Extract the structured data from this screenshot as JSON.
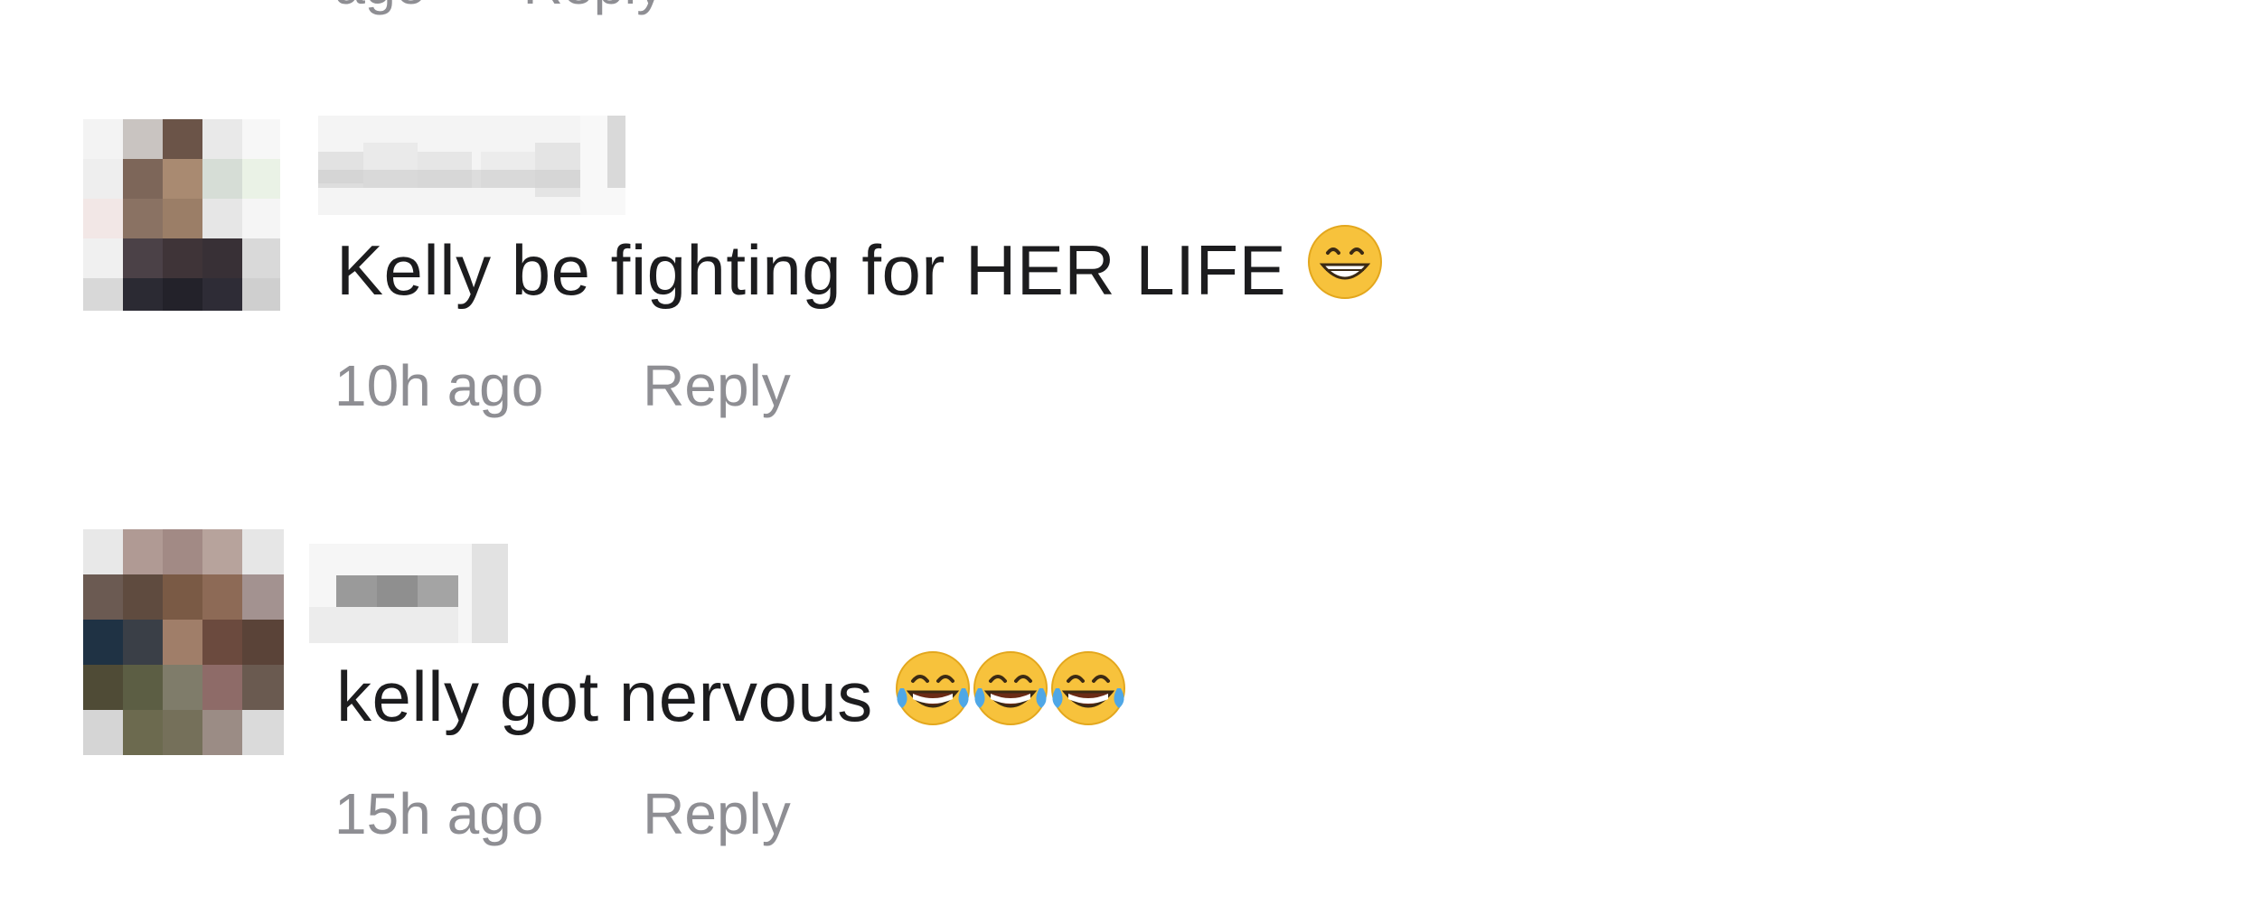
{
  "previous_comment": {
    "meta_partial": [
      "ago",
      "Reply"
    ]
  },
  "comments": [
    {
      "username": "",
      "text": "Kelly be fighting for HER LIFE",
      "emojis": [
        "grinning-face-with-smiling-eyes"
      ],
      "timestamp": "10h ago",
      "reply_label": "Reply"
    },
    {
      "username": "",
      "text": "kelly got nervous",
      "emojis": [
        "face-with-tears-of-joy",
        "face-with-tears-of-joy",
        "face-with-tears-of-joy"
      ],
      "timestamp": "15h ago",
      "reply_label": "Reply"
    }
  ],
  "colors": {
    "text": "#1c1c1e",
    "meta": "#8e8e93",
    "background": "#ffffff",
    "emoji_face": "#f7c23c",
    "emoji_tear": "#4fa7e6"
  }
}
